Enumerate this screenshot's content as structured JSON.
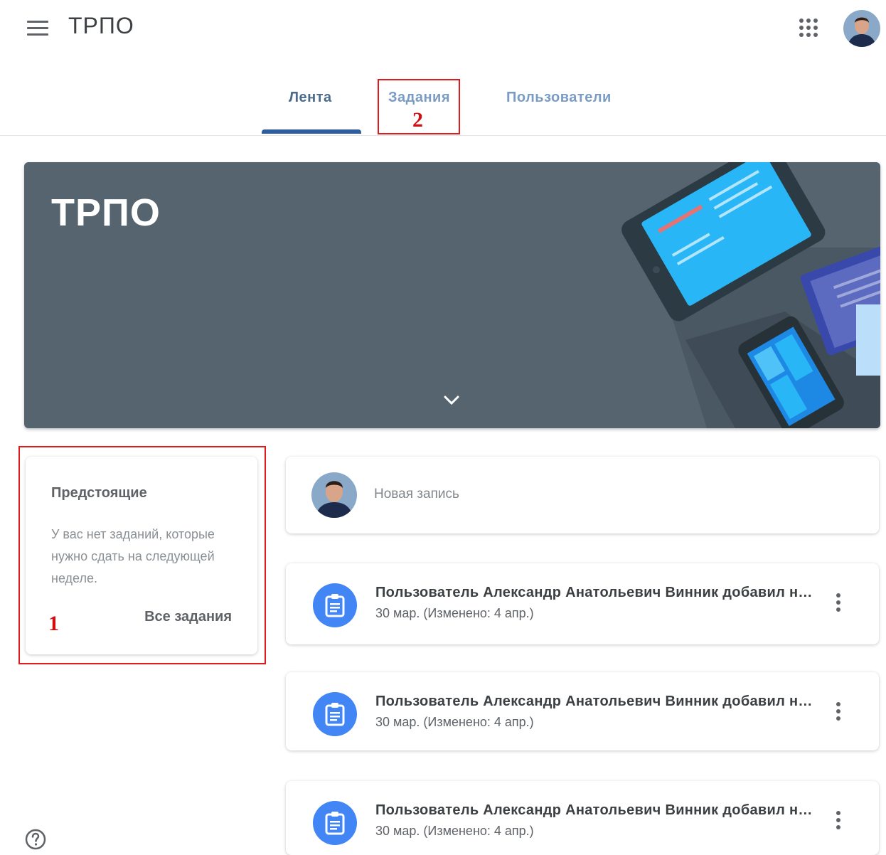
{
  "header": {
    "menu_icon": "hamburger-menu-icon",
    "title": "ТРПО",
    "apps_icon": "apps-grid-icon",
    "avatar": "user-avatar"
  },
  "tabs": [
    {
      "label": "Лента",
      "active": true
    },
    {
      "label": "Задания",
      "active": false
    },
    {
      "label": "Пользователи",
      "active": false
    }
  ],
  "annotations": {
    "marker_1": "1",
    "marker_2": "2",
    "color": "#e01b1b"
  },
  "banner": {
    "title": "ТРПО",
    "expand_icon": "chevron-down-icon",
    "color": "#566470"
  },
  "upcoming": {
    "title": "Предстоящие",
    "text": "У вас нет заданий, которые нужно сдать на следующей неделе.",
    "link": "Все задания"
  },
  "new_post": {
    "placeholder": "Новая запись"
  },
  "posts": [
    {
      "icon": "assignment-icon",
      "title": "Пользователь Александр Анатольевич Винник добавил новое задание",
      "date": "30 мар. (Изменено: 4 апр.)"
    },
    {
      "icon": "assignment-icon",
      "title": "Пользователь Александр Анатольевич Винник добавил новое задание",
      "date": "30 мар. (Изменено: 4 апр.)"
    },
    {
      "icon": "assignment-icon",
      "title": "Пользователь Александр Анатольевич Винник добавил новое задание",
      "date": "30 мар. (Изменено: 4 апр.)"
    }
  ],
  "footer": {
    "help_icon": "help-circle-icon"
  },
  "colors": {
    "accent": "#2f5d9e",
    "post_icon_bg": "#4285f4"
  }
}
